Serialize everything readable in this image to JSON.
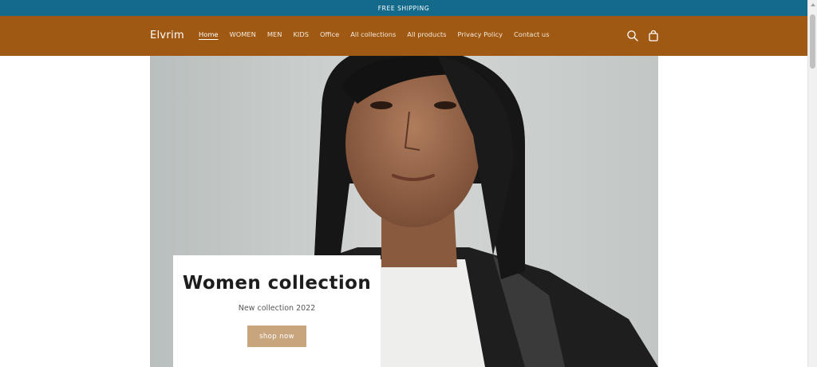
{
  "announcement": {
    "text": "FREE SHIPPING"
  },
  "header": {
    "logo": "Elvrim",
    "nav": [
      {
        "label": "Home",
        "active": true
      },
      {
        "label": "WOMEN"
      },
      {
        "label": "MEN"
      },
      {
        "label": "KIDS"
      },
      {
        "label": "Office"
      },
      {
        "label": "All collections"
      },
      {
        "label": "All products"
      },
      {
        "label": "Privacy Policy"
      },
      {
        "label": "Contact us"
      }
    ],
    "icons": [
      "search-icon",
      "cart-icon"
    ]
  },
  "hero": {
    "title": "Women collection",
    "subtitle": "New collection 2022",
    "button": "shop now"
  },
  "colors": {
    "announcement_bg": "#136a8a",
    "header_bg": "#9f5913",
    "button_bg": "#c9a57e"
  }
}
